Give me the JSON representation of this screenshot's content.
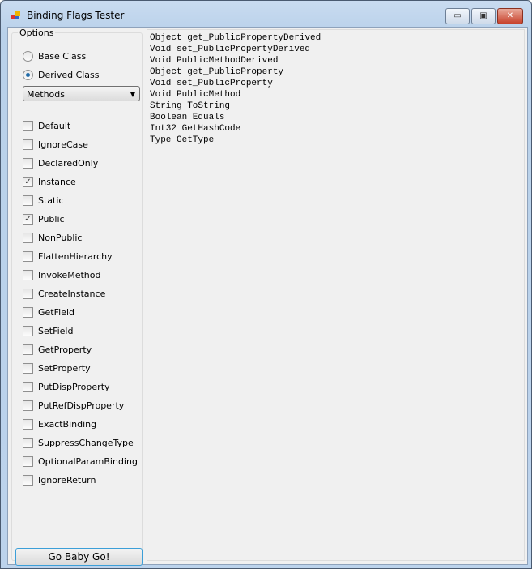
{
  "window": {
    "title": "Binding Flags Tester",
    "minimize": "▭",
    "maximize": "▣",
    "close": "✕"
  },
  "options": {
    "label": "Options",
    "radios": [
      {
        "label": "Base Class",
        "selected": false
      },
      {
        "label": "Derived Class",
        "selected": true
      }
    ],
    "member_type": "Methods",
    "flags": [
      {
        "label": "Default",
        "checked": false
      },
      {
        "label": "IgnoreCase",
        "checked": false
      },
      {
        "label": "DeclaredOnly",
        "checked": false
      },
      {
        "label": "Instance",
        "checked": true
      },
      {
        "label": "Static",
        "checked": false
      },
      {
        "label": "Public",
        "checked": true
      },
      {
        "label": "NonPublic",
        "checked": false
      },
      {
        "label": "FlattenHierarchy",
        "checked": false
      },
      {
        "label": "InvokeMethod",
        "checked": false
      },
      {
        "label": "CreateInstance",
        "checked": false
      },
      {
        "label": "GetField",
        "checked": false
      },
      {
        "label": "SetField",
        "checked": false
      },
      {
        "label": "GetProperty",
        "checked": false
      },
      {
        "label": "SetProperty",
        "checked": false
      },
      {
        "label": "PutDispProperty",
        "checked": false
      },
      {
        "label": "PutRefDispProperty",
        "checked": false
      },
      {
        "label": "ExactBinding",
        "checked": false
      },
      {
        "label": "SuppressChangeType",
        "checked": false
      },
      {
        "label": "OptionalParamBinding",
        "checked": false
      },
      {
        "label": "IgnoreReturn",
        "checked": false
      }
    ],
    "go_button": "Go Baby Go!"
  },
  "output": [
    "Object get_PublicPropertyDerived",
    "Void set_PublicPropertyDerived",
    "Void PublicMethodDerived",
    "Object get_PublicProperty",
    "Void set_PublicProperty",
    "Void PublicMethod",
    "String ToString",
    "Boolean Equals",
    "Int32 GetHashCode",
    "Type GetType"
  ]
}
